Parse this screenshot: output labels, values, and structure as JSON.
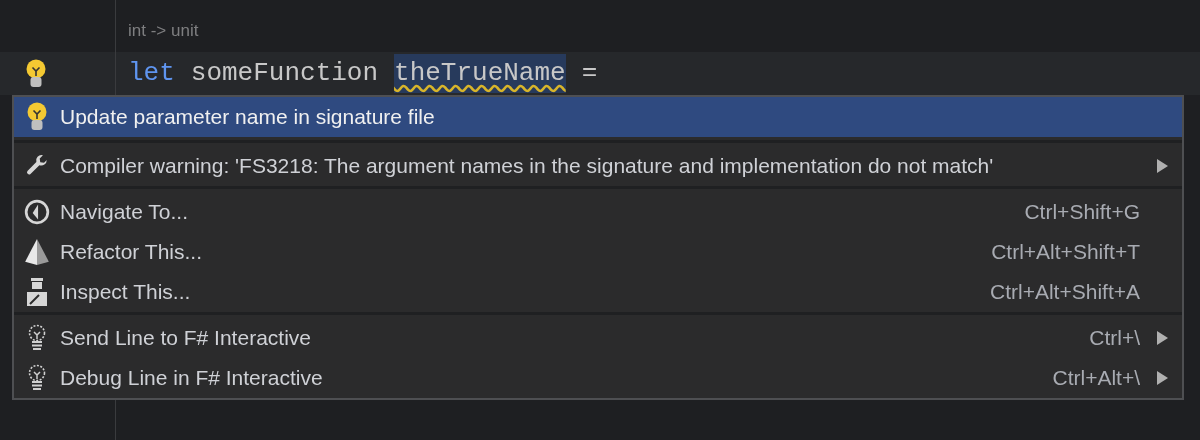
{
  "editor": {
    "type_hint": "int -> unit",
    "code": [
      {
        "text": "let",
        "kind": "keyword"
      },
      {
        "text": "someFunction",
        "kind": "identifier"
      },
      {
        "text": "theTrueName",
        "kind": "warning"
      },
      {
        "text": "=",
        "kind": "operator"
      }
    ]
  },
  "menu": {
    "sections": [
      {
        "items": [
          {
            "label": "Update parameter name in signature file",
            "selected": true,
            "submenu": false
          }
        ]
      },
      {
        "items": [
          {
            "label": "Compiler warning: 'FS3218: The argument names in the signature and implementation do not match'",
            "selected": false,
            "submenu": true
          }
        ]
      },
      {
        "items": [
          {
            "label": "Navigate To...",
            "shortcut": "Ctrl+Shift+G",
            "selected": false,
            "submenu": false
          },
          {
            "label": "Refactor This...",
            "shortcut": "Ctrl+Alt+Shift+T",
            "selected": false,
            "submenu": false
          },
          {
            "label": "Inspect This...",
            "shortcut": "Ctrl+Alt+Shift+A",
            "selected": false,
            "submenu": false
          }
        ]
      },
      {
        "items": [
          {
            "label": "Send Line to F# Interactive",
            "shortcut": "Ctrl+\\",
            "selected": false,
            "submenu": true
          },
          {
            "label": "Debug Line in F# Interactive",
            "shortcut": "Ctrl+Alt+\\",
            "selected": false,
            "submenu": true
          }
        ]
      }
    ]
  }
}
